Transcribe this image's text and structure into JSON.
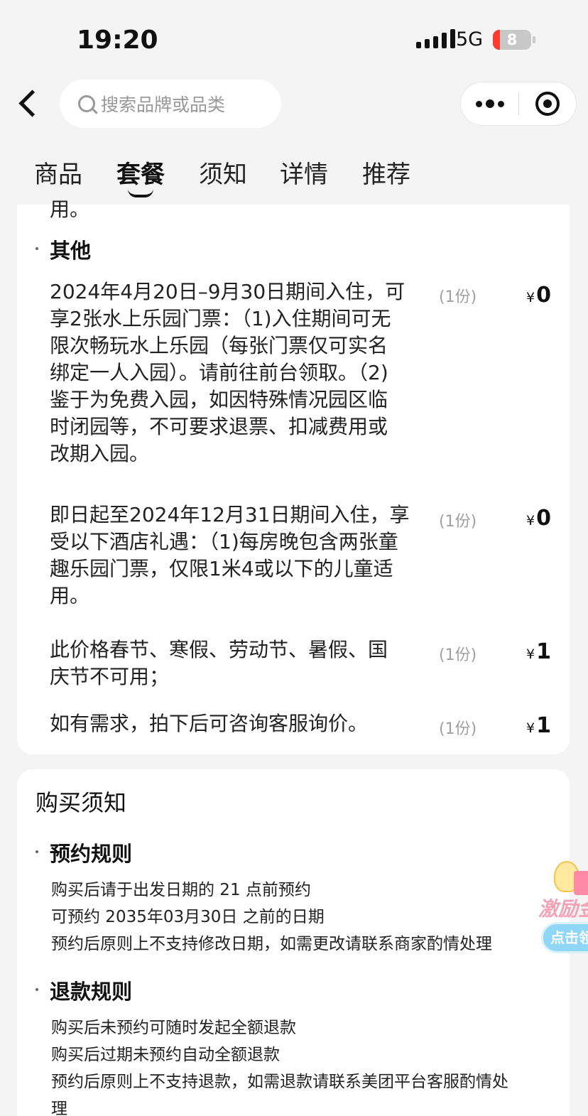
{
  "status": {
    "time": "19:20",
    "network": "5G",
    "battery": "8"
  },
  "nav": {
    "search_placeholder": "搜索品牌或品类"
  },
  "tabs": [
    {
      "label": "商品"
    },
    {
      "label": "套餐"
    },
    {
      "label": "须知"
    },
    {
      "label": "详情"
    },
    {
      "label": "推荐"
    }
  ],
  "package": {
    "cut_line": "用。",
    "section_title": "其他",
    "items": [
      {
        "lines": [
          "2024年4月20日–9月30日期间入住，可",
          "享2张水上乐园门票：（1)入住期间可无",
          "限次畅玩水上乐园（每张门票仅可实名",
          "绑定一人入园）。请前往前台领取。（2)",
          "鉴于为免费入园，如因特殊情况园区临",
          "时闭园等，不可要求退票、扣减费用或",
          "改期入园。"
        ],
        "qty": "(1份)",
        "currency": "¥",
        "price": "0"
      },
      {
        "lines": [
          "即日起至2024年12月31日期间入住，享",
          "受以下酒店礼遇：（1)每房晚包含两张童",
          "趣乐园门票，仅限1米4或以下的儿童适",
          "用。"
        ],
        "qty": "(1份)",
        "currency": "¥",
        "price": "0"
      },
      {
        "lines": [
          "此价格春节、寒假、劳动节、暑假、国",
          "庆节不可用；"
        ],
        "qty": "(1份)",
        "currency": "¥",
        "price": "1"
      },
      {
        "lines": [
          "如有需求，拍下后可咨询客服询价。"
        ],
        "qty": "(1份)",
        "currency": "¥",
        "price": "1"
      }
    ],
    "watermark": "已有9999人下单"
  },
  "notice": {
    "title": "购买须知",
    "sections": [
      {
        "title": "预约规则",
        "lines": [
          "购买后请于出发日期的 21 点前预约",
          "可预约 2035年03月30日 之前的日期",
          "预约后原则上不支持修改日期，如需更改请联系商家酌情处理"
        ]
      },
      {
        "title": "退款规则",
        "lines": [
          "购买后未预约可随时发起全额退款",
          "购买后过期未预约自动全额退款",
          "预约后原则上不支持退款，如需退款请联系美团平台客服酌情处",
          "理"
        ]
      }
    ]
  },
  "promo": {
    "label": "激励金",
    "button": "点击领"
  },
  "colors": {
    "background": "#f4f4f4",
    "card": "#ffffff",
    "muted": "#a0a0a0",
    "battery_low": "#ff3b30"
  }
}
